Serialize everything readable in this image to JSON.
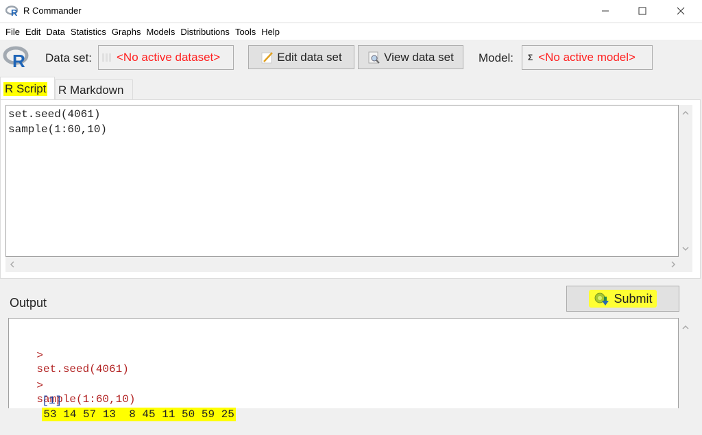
{
  "window": {
    "title": "R Commander",
    "controls": {
      "minimize": "—",
      "maximize": "☐",
      "close": "✕"
    }
  },
  "menu": [
    "File",
    "Edit",
    "Data",
    "Statistics",
    "Graphs",
    "Models",
    "Distributions",
    "Tools",
    "Help"
  ],
  "toolbar": {
    "dataset_label": "Data set:",
    "dataset_value": "<No active dataset>",
    "edit_button": "Edit data set",
    "view_button": "View data set",
    "model_label": "Model:",
    "model_value": "<No active model>",
    "model_icon_glyph": "Σ"
  },
  "tabs": [
    {
      "label": "R Script",
      "active": true,
      "highlighted": true
    },
    {
      "label": "R Markdown",
      "active": false
    }
  ],
  "script": {
    "lines": [
      "set.seed(4061)",
      "sample(1:60,10)"
    ]
  },
  "output_panel": {
    "label": "Output",
    "submit_label": "Submit",
    "lines": [
      {
        "prompt": ">",
        "text": "set.seed(4061)"
      },
      {
        "prompt": ">",
        "text": "sample(1:60,10)"
      }
    ],
    "result_index": "[1]",
    "result_values": "53 14 57 13  8 45 11 50 59 25"
  },
  "colors": {
    "highlight": "#ffff00",
    "warning_text": "#ff2020",
    "prompt_color": "#b22222",
    "index_color": "#1a3fa0"
  }
}
